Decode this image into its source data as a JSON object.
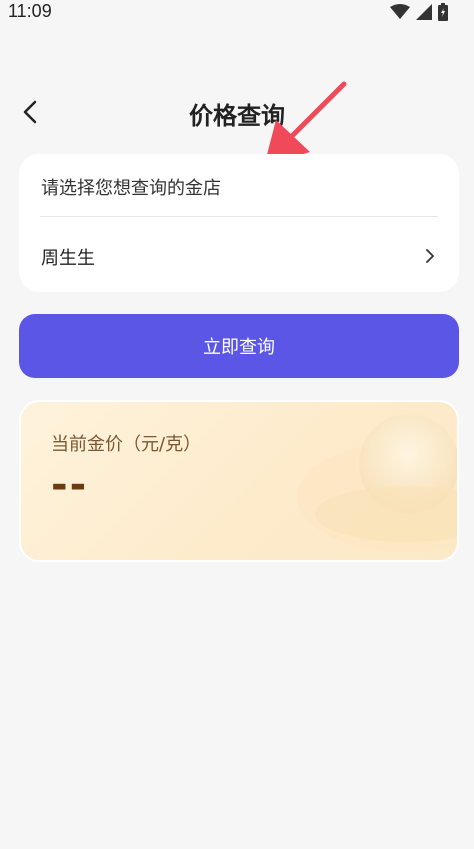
{
  "status_bar": {
    "time": "11:09"
  },
  "header": {
    "title": "价格查询"
  },
  "store_selector": {
    "hint": "请选择您想查询的金店",
    "selected_store": "周生生"
  },
  "query_button": {
    "label": "立即查询"
  },
  "price_card": {
    "label": "当前金价（元/克）",
    "value": "--"
  },
  "colors": {
    "accent": "#5b56e6",
    "price_text": "#6b3a10",
    "arrow": "#f04a5a"
  },
  "icons": [
    "wifi-icon",
    "signal-icon",
    "battery-icon",
    "back-arrow-icon",
    "chevron-right-icon",
    "pointer-arrow-icon",
    "gold-ingot-icon"
  ]
}
